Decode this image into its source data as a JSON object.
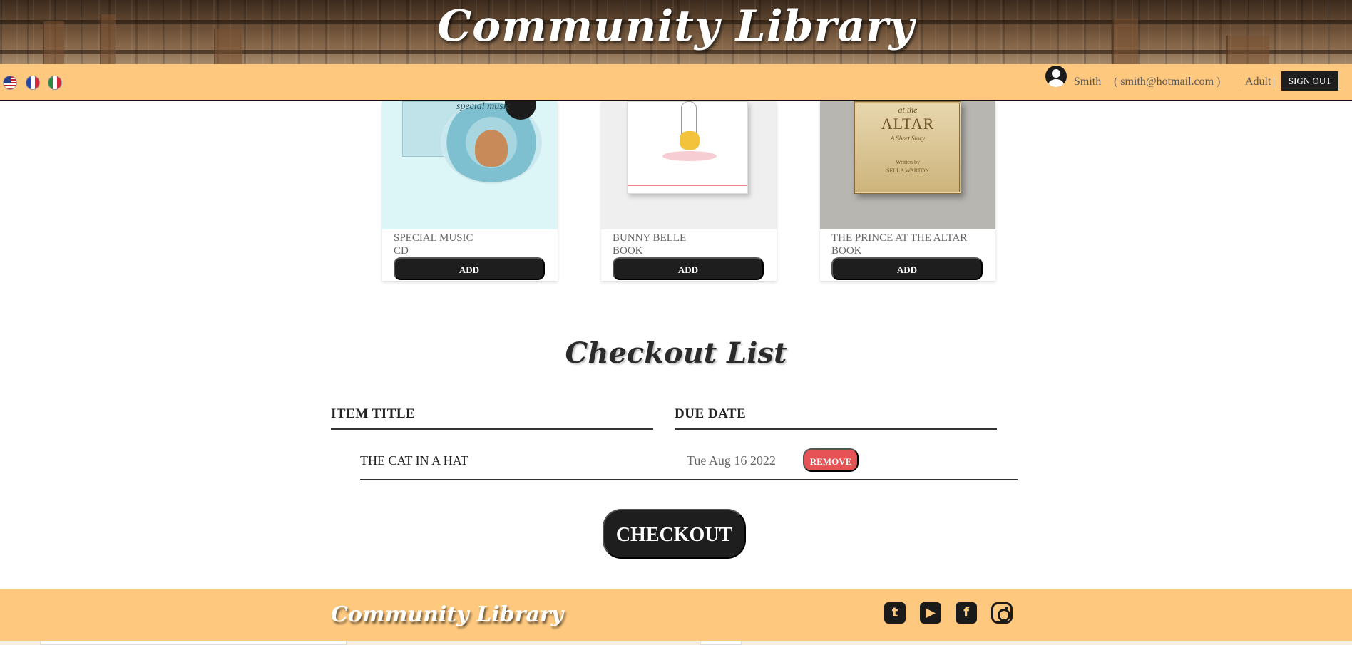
{
  "header": {
    "title": "Community Library"
  },
  "languages": [
    {
      "name": "us-flag-icon"
    },
    {
      "name": "fr-flag-icon"
    },
    {
      "name": "it-flag-icon"
    }
  ],
  "user": {
    "name": "Smith",
    "email": "( smith@hotmail.com )",
    "separator": "|",
    "role": "Adult",
    "signout_label": "SIGN OUT"
  },
  "catalog": {
    "items": [
      {
        "title": "SPECIAL MUSIC",
        "type": "CD",
        "add_label": "ADD"
      },
      {
        "title": "BUNNY BELLE",
        "type": "BOOK",
        "add_label": "ADD"
      },
      {
        "title": "THE PRINCE AT THE ALTAR",
        "type": "BOOK",
        "add_label": "ADD"
      }
    ]
  },
  "cover_text": {
    "music_word": "special music",
    "altar_top": "at the",
    "altar_main": "ALTAR",
    "altar_sub": "A Short Story",
    "altar_written": "Written by",
    "altar_author": "SELLA WARTON"
  },
  "checkout": {
    "title": "Checkout List",
    "columns": [
      "ITEM TITLE",
      "DUE DATE"
    ],
    "rows": [
      {
        "title": "THE CAT IN A HAT",
        "due_date": "Tue Aug 16 2022",
        "remove_label": "REMOVE"
      }
    ],
    "checkout_label": "CHECKOUT"
  },
  "footer": {
    "title": "Community Library",
    "social": [
      "twitter-icon",
      "youtube-icon",
      "facebook-icon",
      "instagram-icon"
    ]
  },
  "colors": {
    "accent": "#fec97f",
    "button_dark": "#1e1e1e",
    "remove_red": "#e65256"
  }
}
